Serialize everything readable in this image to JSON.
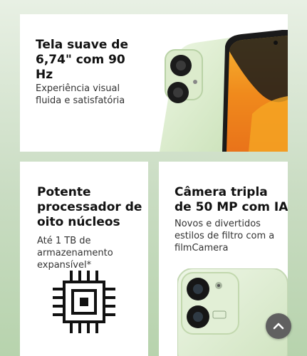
{
  "cards": [
    {
      "title": "Tela suave de 6,74\" com 90 Hz",
      "description": "Experiência visual fluida e satisfatória"
    },
    {
      "title": "Potente processador de oito núcleos",
      "description": "Até 1 TB de armazenamento expansível*"
    },
    {
      "title": "Câmera tripla de 50 MP com IA",
      "description": "Novos e divertidos estilos de filtro com a filmCamera"
    }
  ],
  "icons": {
    "chip": "cpu-chip-icon",
    "scroll_top": "chevron-up-icon"
  },
  "colors": {
    "background": "#c9dcc2",
    "card": "#ffffff",
    "phone_body": "#d9ecc9",
    "screen_orange": "#f29b1e",
    "button": "#606060"
  }
}
